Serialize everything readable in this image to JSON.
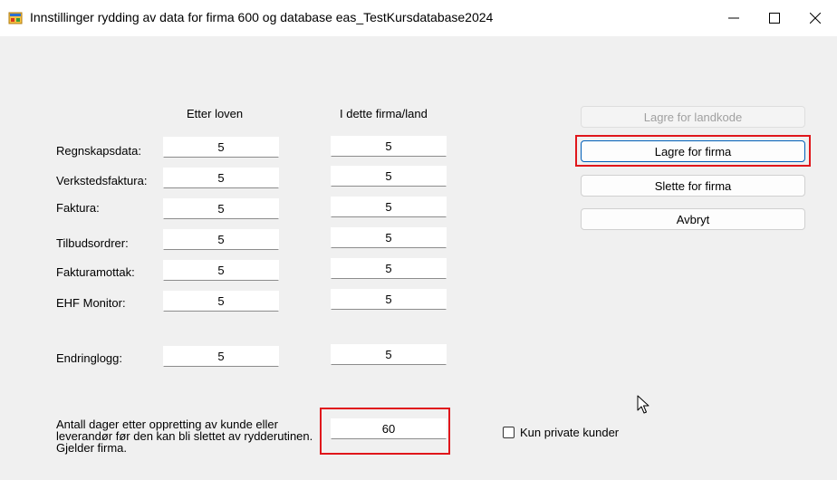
{
  "window": {
    "title": "Innstillinger rydding av data for firma 600 og database eas_TestKursdatabase2024",
    "controls": {
      "minimize": "minimize",
      "maximize": "maximize",
      "close": "close"
    }
  },
  "columns": {
    "law": "Etter loven",
    "company": "I dette firma/land"
  },
  "rows": [
    {
      "label": "Regnskapsdata:",
      "law": "5",
      "company": "5"
    },
    {
      "label": "Verkstedsfaktura:",
      "law": "5",
      "company": "5"
    },
    {
      "label": "Faktura:",
      "law": "5",
      "company": "5"
    },
    {
      "label": "Tilbudsordrer:",
      "law": "5",
      "company": "5"
    },
    {
      "label": "Fakturamottak:",
      "law": "5",
      "company": "5"
    },
    {
      "label": "EHF Monitor:",
      "law": "5",
      "company": "5"
    },
    {
      "label": "Endringlogg:",
      "law": "5",
      "company": "5"
    }
  ],
  "buttons": {
    "save_country": "Lagre for landkode",
    "save_company": "Lagre for firma",
    "delete_company": "Slette for firma",
    "cancel": "Avbryt"
  },
  "customer_days": {
    "label": "Antall dager etter oppretting av kunde eller leverandør før den kan bli slettet av rydderutinen. Gjelder firma.",
    "value": "60"
  },
  "private_customers": {
    "label": "Kun private kunder",
    "checked": false
  },
  "colors": {
    "highlight": "#e0161b",
    "focus": "#005fb8",
    "background": "#f0f0f0"
  }
}
